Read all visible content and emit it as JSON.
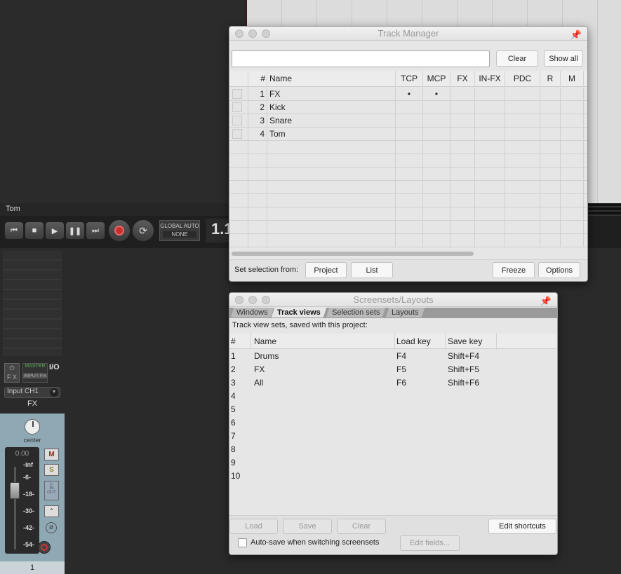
{
  "daw": {
    "track_label": "Tom",
    "global_auto": "GLOBAL AUTO",
    "global_auto_mode": "NONE",
    "time_readout": "1.1",
    "mixer": {
      "master_label": "MASTER",
      "input_fx": "INPUT FX",
      "io_label": "I/O",
      "fx_label": "F X",
      "input_select": "Input CH1",
      "track_name": "FX",
      "pan_label": "center",
      "volume_readout": "0.00",
      "meter_scale": [
        "-inf",
        "-6-",
        "-18-",
        "-30-",
        "-42-",
        "-54-"
      ],
      "mute": "M",
      "solo": "S",
      "in_out": "IN OUT",
      "track_number": "1"
    }
  },
  "track_manager": {
    "title": "Track Manager",
    "filter_value": "",
    "clear": "Clear",
    "show_all": "Show all",
    "columns": [
      "#",
      "Name",
      "TCP",
      "MCP",
      "FX",
      "IN-FX",
      "PDC",
      "R",
      "M"
    ],
    "rows": [
      {
        "num": "1",
        "name": "FX",
        "tcp": "•",
        "mcp": "•"
      },
      {
        "num": "2",
        "name": "Kick",
        "tcp": "",
        "mcp": ""
      },
      {
        "num": "3",
        "name": "Snare",
        "tcp": "",
        "mcp": ""
      },
      {
        "num": "4",
        "name": "Tom",
        "tcp": "",
        "mcp": ""
      }
    ],
    "set_selection_from": "Set selection from:",
    "project": "Project",
    "list": "List",
    "freeze": "Freeze",
    "options": "Options"
  },
  "screensets": {
    "title": "Screensets/Layouts",
    "tabs": [
      "Windows",
      "Track views",
      "Selection sets",
      "Layouts"
    ],
    "active_tab": "Track views",
    "subtitle": "Track view sets, saved with this project:",
    "columns": [
      "#",
      "Name",
      "Load key",
      "Save key"
    ],
    "rows": [
      {
        "num": "1",
        "name": "Drums",
        "load": "F4",
        "save": "Shift+F4"
      },
      {
        "num": "2",
        "name": "FX",
        "load": "F5",
        "save": "Shift+F5"
      },
      {
        "num": "3",
        "name": "All",
        "load": "F6",
        "save": "Shift+F6"
      },
      {
        "num": "4",
        "name": "",
        "load": "",
        "save": ""
      },
      {
        "num": "5",
        "name": "",
        "load": "",
        "save": ""
      },
      {
        "num": "6",
        "name": "",
        "load": "",
        "save": ""
      },
      {
        "num": "7",
        "name": "",
        "load": "",
        "save": ""
      },
      {
        "num": "8",
        "name": "",
        "load": "",
        "save": ""
      },
      {
        "num": "9",
        "name": "",
        "load": "",
        "save": ""
      },
      {
        "num": "10",
        "name": "",
        "load": "",
        "save": ""
      }
    ],
    "load": "Load",
    "save": "Save",
    "clear": "Clear",
    "edit_shortcuts": "Edit shortcuts",
    "autosave_label": "Auto-save when switching screensets",
    "edit_fields": "Edit fields..."
  }
}
